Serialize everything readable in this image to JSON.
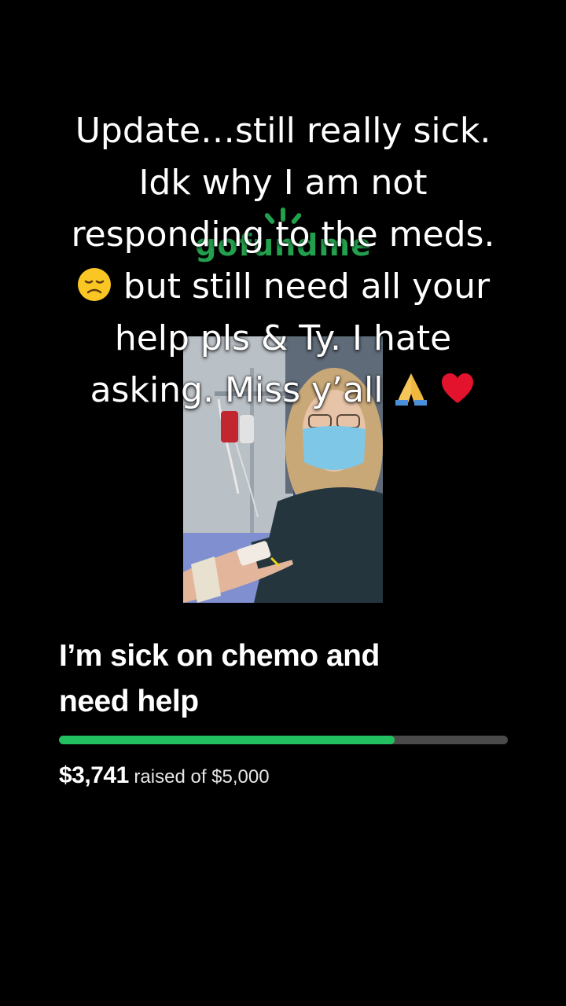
{
  "caption": {
    "lines": [
      "Update…still really sick.",
      "Idk why I am not",
      "responding to the meds.",
      "but still need all your",
      "help pls & Ty. I hate",
      "asking. Miss y’all"
    ],
    "emojis": [
      "disappointed-face-icon",
      "folded-hands-icon",
      "red-heart-icon"
    ]
  },
  "logo": {
    "text": "gofundme",
    "color": "#23a04e"
  },
  "campaign": {
    "title_line1": "I’m sick on chemo and",
    "title_line2": "need help",
    "raised_amount": "$3,741",
    "raised_suffix": " raised of $5,000",
    "goal": 5000,
    "raised": 3741,
    "progress_fraction": 0.748,
    "progress_color": "#22c061",
    "track_color": "#4a4a4a"
  }
}
